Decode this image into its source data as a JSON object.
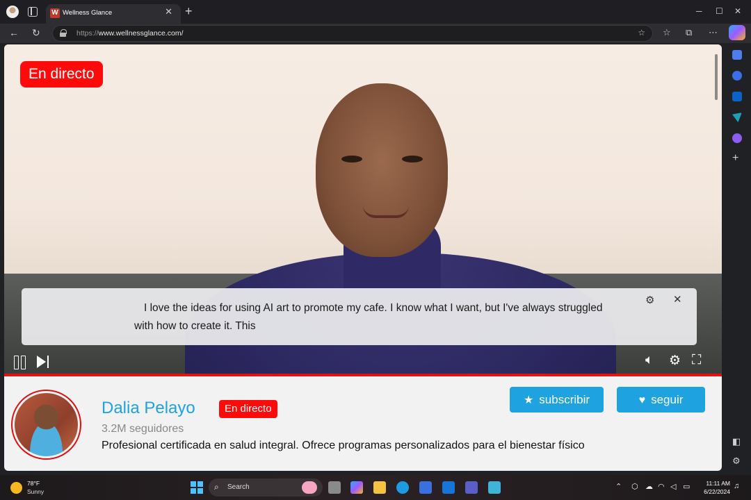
{
  "browser": {
    "tab_title": "Wellness Glance",
    "tab_favicon_letter": "W",
    "url_protocol": "https://",
    "url_host": "www.wellnessglance.com/"
  },
  "video": {
    "live_badge": "En directo",
    "caption": "I love the ideas for using AI art to promote my cafe. I know what I want, but I've always struggled with how to create it. This"
  },
  "channel": {
    "name": "Dalia Pelayo",
    "live_badge": "En directo",
    "followers": "3.2M seguidores",
    "bio": "Profesional certificada en salud integral. Ofrece programas personalizados para el bienestar físico",
    "subscribe_label": "subscribir",
    "follow_label": "seguir"
  },
  "taskbar": {
    "weather_temp": "78°F",
    "weather_condition": "Sunny",
    "search_placeholder": "Search",
    "time": "11:11 AM",
    "date": "6/22/2024"
  },
  "colors": {
    "live_red": "#ff0a0a",
    "accent_blue": "#1ea3e0",
    "progress_red": "#e01212"
  }
}
